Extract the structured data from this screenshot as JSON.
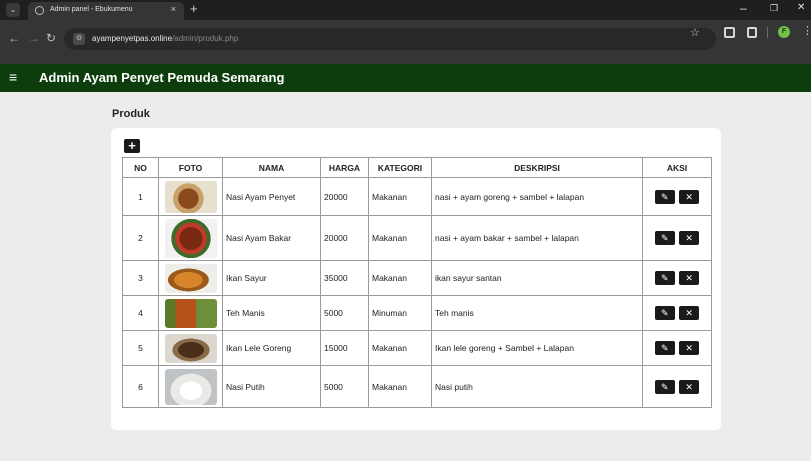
{
  "browser": {
    "tab_title": "Admin panel - Ebukumenu",
    "tab_close": "×",
    "new_tab": "+",
    "url_host": "ayampenyetpas.online",
    "url_path": "/admin/produk.php",
    "profile_initial": "F"
  },
  "header": {
    "menu_icon": "≡",
    "title": "Admin Ayam Penyet Pemuda Semarang"
  },
  "page": {
    "heading": "Produk",
    "add_label": "+"
  },
  "table": {
    "columns": [
      "NO",
      "FOTO",
      "NAMA",
      "HARGA",
      "KATEGORI",
      "DESKRIPSI",
      "AKSI"
    ],
    "rows": [
      {
        "no": "1",
        "nama": "Nasi Ayam Penyet",
        "harga": "20000",
        "kategori": "Makanan",
        "deskripsi": "nasi + ayam goreng + sambel + lalapan",
        "photo": "ayam-penyet"
      },
      {
        "no": "2",
        "nama": "Nasi Ayam Bakar",
        "harga": "20000",
        "kategori": "Makanan",
        "deskripsi": "nasi + ayam bakar + sambel + lalapan",
        "photo": "ayam-bakar"
      },
      {
        "no": "3",
        "nama": "Ikan Sayur",
        "harga": "35000",
        "kategori": "Makanan",
        "deskripsi": "ikan sayur santan",
        "photo": "ikan-sayur"
      },
      {
        "no": "4",
        "nama": "Teh Manis",
        "harga": "5000",
        "kategori": "Minuman",
        "deskripsi": "Teh manis",
        "photo": "teh-manis"
      },
      {
        "no": "5",
        "nama": "Ikan Lele Goreng",
        "harga": "15000",
        "kategori": "Makanan",
        "deskripsi": "Ikan lele goreng + Sambel + Lalapan",
        "photo": "lele-goreng"
      },
      {
        "no": "6",
        "nama": "Nasi Putih",
        "harga": "5000",
        "kategori": "Makanan",
        "deskripsi": "Nasi putih",
        "photo": "nasi-putih"
      }
    ],
    "edit_icon": "✎",
    "delete_icon": "✕"
  },
  "colors": {
    "appbar": "#0d3d0d",
    "page_bg": "#ececec",
    "action_button": "#1a1a1a"
  }
}
